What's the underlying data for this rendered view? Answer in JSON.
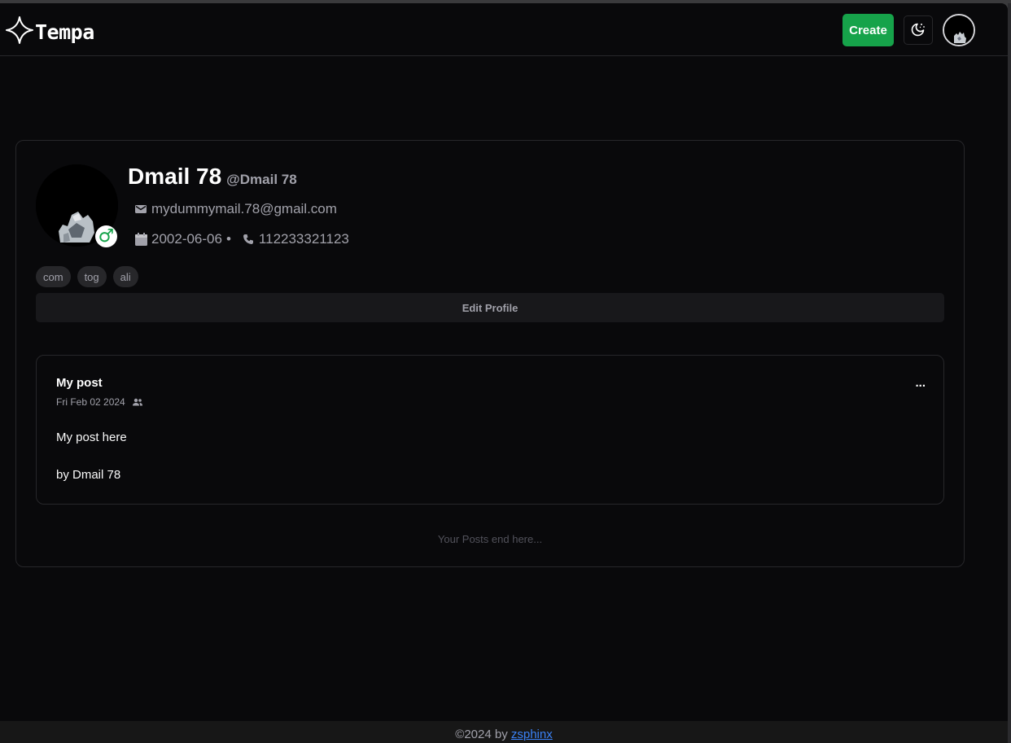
{
  "header": {
    "app_name": "Tempa",
    "create_label": "Create",
    "logo_icon": "four-point-star-icon",
    "theme_icon": "moon-stars-icon",
    "avatar_icon": "user-avatar"
  },
  "profile": {
    "display_name": "Dmail 78",
    "handle": "@Dmail 78",
    "email": "mydummymail.78@gmail.com",
    "dob": "2002-06-06",
    "separator": "•",
    "phone": "112233321123",
    "gender_symbol": "♂",
    "tags": [
      "com",
      "tog",
      "ali"
    ],
    "edit_label": "Edit Profile"
  },
  "posts": [
    {
      "title": "My post",
      "date": "Fri Feb 02 2024",
      "visibility_icon": "people-icon",
      "body": "My post here",
      "author": "by Dmail 78",
      "more_label": "..."
    }
  ],
  "end_note": "Your Posts end here...",
  "footer": {
    "prefix": "©2024 by ",
    "link_text": "zsphinx"
  },
  "colors": {
    "background": "#09090b",
    "accent_green": "#16a34a",
    "link_blue": "#3b82f6",
    "border": "#27272a",
    "muted_text": "#a1a1aa"
  }
}
